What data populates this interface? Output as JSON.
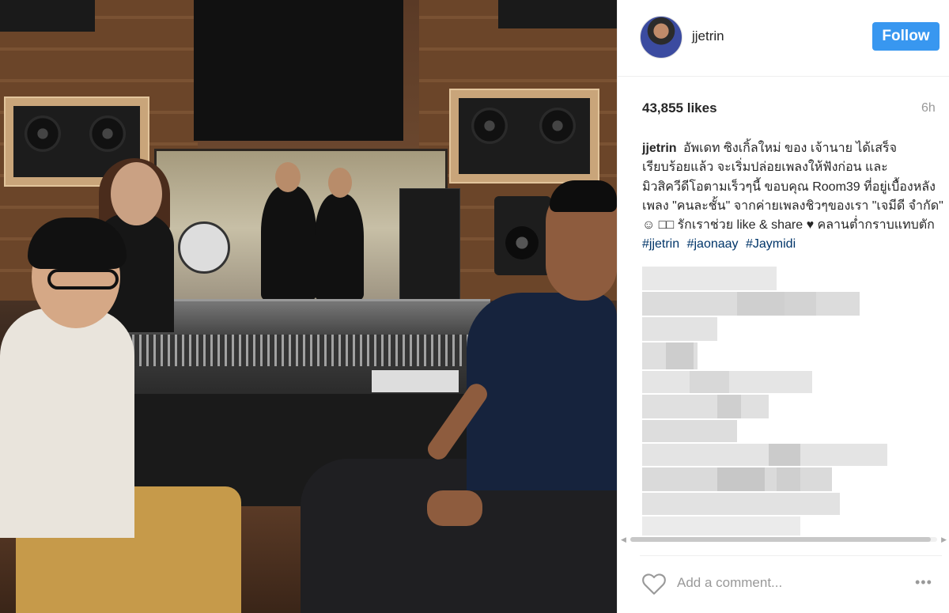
{
  "post": {
    "username": "jjetrin",
    "follow_label": "Follow",
    "likes": "43,855 likes",
    "time": "6h",
    "caption_user": "jjetrin",
    "caption_text": "อัพเดท ซิงเกิ้ลใหม่ ของ เจ้านาย ได้เสร็จเรียบร้อยแล้ว จะเริ่มปล่อยเพลงให้ฟังก่อน และมิวสิควีดีโอตามเร็วๆนี้ ขอบคุณ Room39 ที่อยู่เบื้องหลังเพลง \"คนละชั้น\" จากค่ายเพลงชิวๆของเรา \"เจมีดี จำกัด\" ☺ □□ รักเราช่วย like & share ♥ คลานต่ำกราบแทบตัก",
    "hashtags": [
      "#jjetrin",
      "#jaonaay",
      "#Jaymidi"
    ],
    "comment_placeholder": "Add a comment...",
    "more_label": "•••"
  },
  "icons": {
    "heart": "heart-outline-icon",
    "more": "more-horizontal-icon"
  },
  "colors": {
    "follow_button": "#3897f0",
    "hashtag": "#003569",
    "muted": "#999999"
  }
}
